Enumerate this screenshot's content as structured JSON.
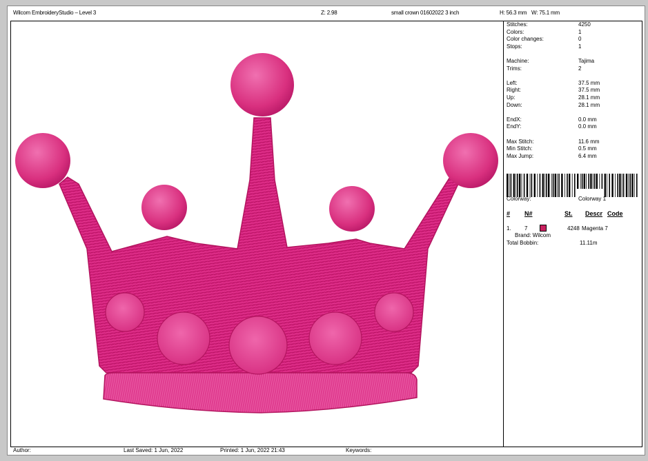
{
  "header": {
    "app_title": "Wilcom EmbroideryStudio – Level 3",
    "zoom": "Z: 2.98",
    "file_name": "small crown 01602022 3  inch",
    "height": "H: 56.3 mm",
    "width": "W: 75.1 mm"
  },
  "design": {
    "thread_color": "#d81f7f",
    "thread_dark": "#a8125e",
    "thread_light": "#ee5ba3",
    "icon": "crown-icon"
  },
  "stats": [
    {
      "label": "Stitches:",
      "value": "4250"
    },
    {
      "label": "Colors:",
      "value": "1"
    },
    {
      "label": "Color changes:",
      "value": "0"
    },
    {
      "label": "Stops:",
      "value": "1"
    }
  ],
  "machine": [
    {
      "label": "Machine:",
      "value": "Tajima"
    },
    {
      "label": "Trims:",
      "value": "2"
    }
  ],
  "extents": [
    {
      "label": "Left:",
      "value": "37.5 mm"
    },
    {
      "label": "Right:",
      "value": "37.5 mm"
    },
    {
      "label": "Up:",
      "value": "28.1 mm"
    },
    {
      "label": "Down:",
      "value": "28.1 mm"
    }
  ],
  "end": [
    {
      "label": "EndX:",
      "value": "0.0 mm"
    },
    {
      "label": "EndY:",
      "value": "0.0 mm"
    }
  ],
  "limits": [
    {
      "label": "Max Stitch:",
      "value": "11.6 mm"
    },
    {
      "label": "Min Stitch:",
      "value": "0.5 mm"
    },
    {
      "label": "Max Jump:",
      "value": "6.4 mm"
    }
  ],
  "colorway": {
    "label": "Colorway:",
    "value": "Colorway 1"
  },
  "table": {
    "headers": {
      "num": "#",
      "needle": "N#",
      "stitches": "St.",
      "descr": "Descr",
      "code": "Code"
    },
    "rows": [
      {
        "num": "1.",
        "needle": "7",
        "swatch": "#c8205f",
        "stitches": "4248",
        "descr": "Magenta 7",
        "brand": "Brand: Wilcom"
      }
    ]
  },
  "bobbin": {
    "label": "Total Bobbin:",
    "value": "11.11m"
  },
  "footer": {
    "author": "Author:",
    "last_saved": "Last Saved:  1 Jun, 2022",
    "printed": "Printed:  1 Jun, 2022 21:43",
    "keywords": "Keywords:"
  }
}
